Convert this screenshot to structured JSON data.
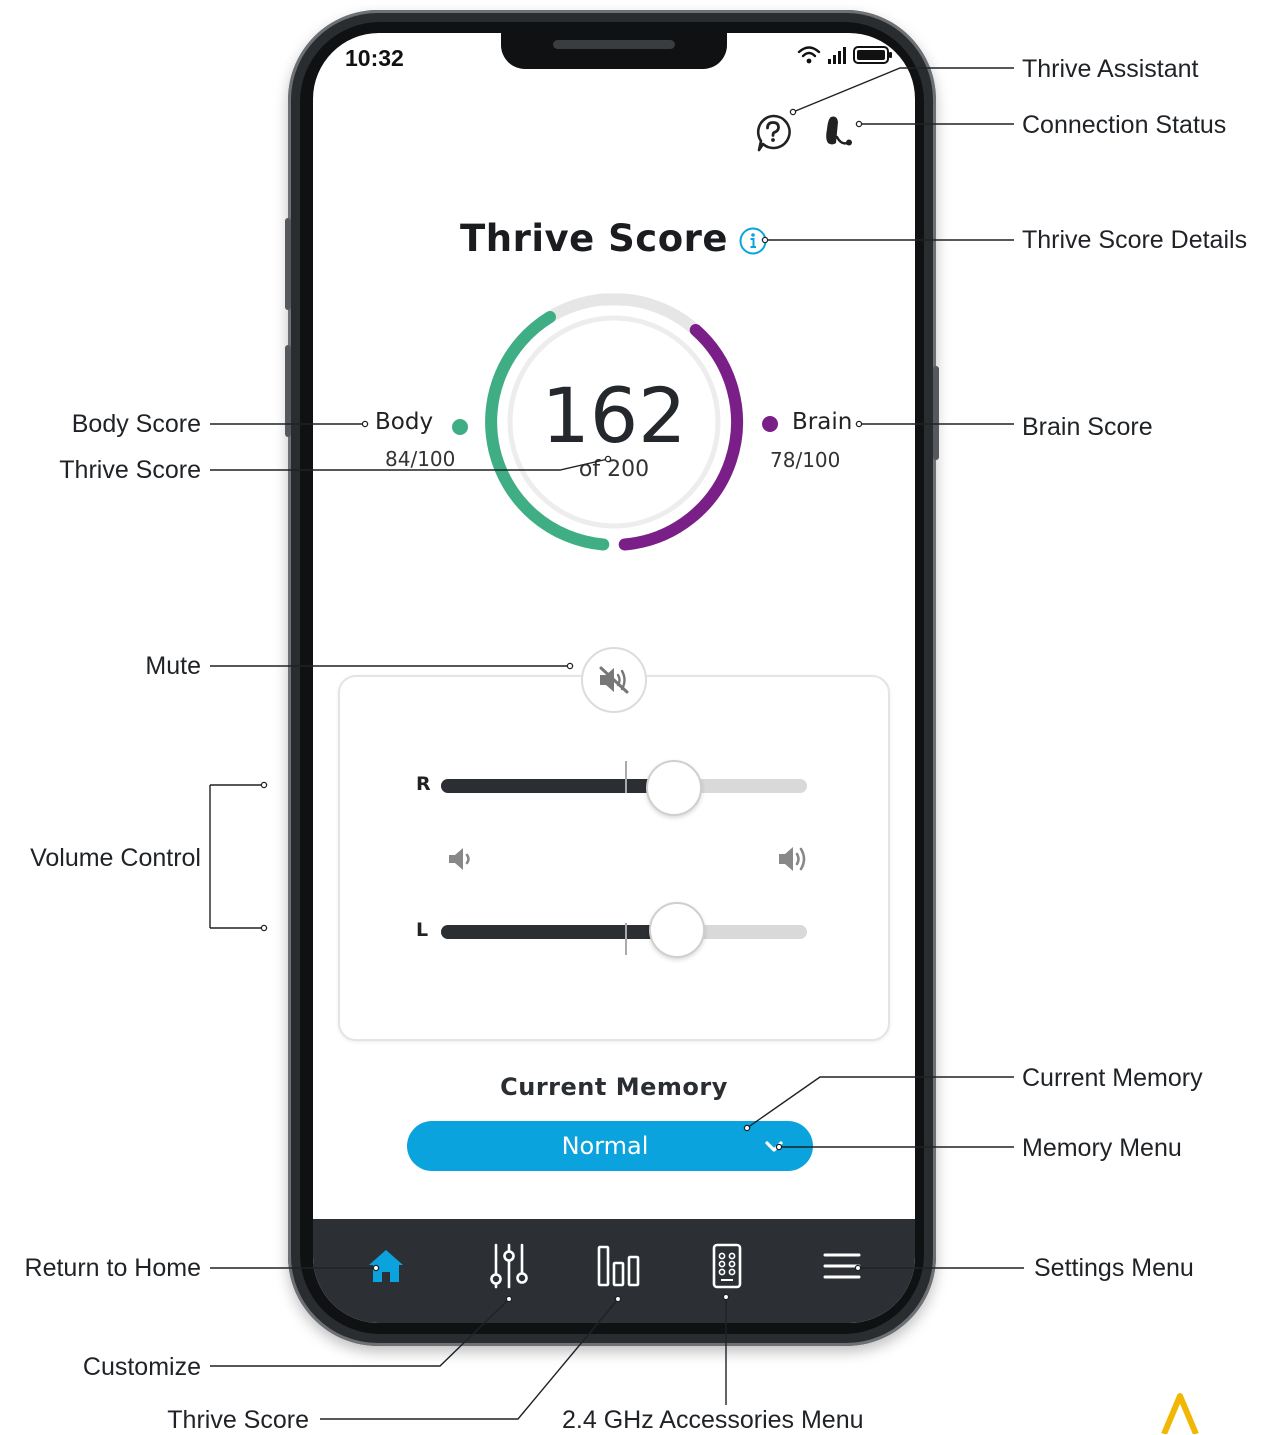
{
  "status_bar": {
    "time": "10:32"
  },
  "thrive": {
    "title": "Thrive Score",
    "score": "162",
    "score_of": "of 200",
    "body_label": "Body",
    "body_value": "84/100",
    "brain_label": "Brain",
    "brain_value": "78/100",
    "body_score_fraction": 0.84,
    "brain_score_fraction": 0.78
  },
  "volume": {
    "right_label": "R",
    "left_label": "L",
    "right_level": 0.63,
    "left_level": 0.64
  },
  "memory": {
    "title": "Current Memory",
    "value": "Normal"
  },
  "tabs": [
    {
      "icon": "home-icon",
      "active": true
    },
    {
      "icon": "sliders-icon",
      "active": false
    },
    {
      "icon": "bar-chart-icon",
      "active": false
    },
    {
      "icon": "remote-icon",
      "active": false
    },
    {
      "icon": "menu-icon",
      "active": false
    }
  ],
  "callouts": {
    "thrive_assistant": "Thrive Assistant",
    "connection_status": "Connection Status",
    "thrive_score_details": "Thrive Score Details",
    "brain_score": "Brain Score",
    "body_score": "Body Score",
    "thrive_score": "Thrive Score",
    "mute": "Mute",
    "volume_control": "Volume Control",
    "current_memory": "Current Memory",
    "memory_menu": "Memory Menu",
    "return_home": "Return to Home",
    "settings_menu": "Settings Menu",
    "customize": "Customize",
    "thrive_score_tab": "Thrive Score",
    "accessories_menu": "2.4 GHz Accessories Menu"
  },
  "colors": {
    "body_green": "#3fae84",
    "brain_purple": "#7a1f87",
    "accent_blue": "#0ba3dd",
    "tabbar_bg": "#2c3034",
    "logo_yellow": "#f2b705"
  }
}
